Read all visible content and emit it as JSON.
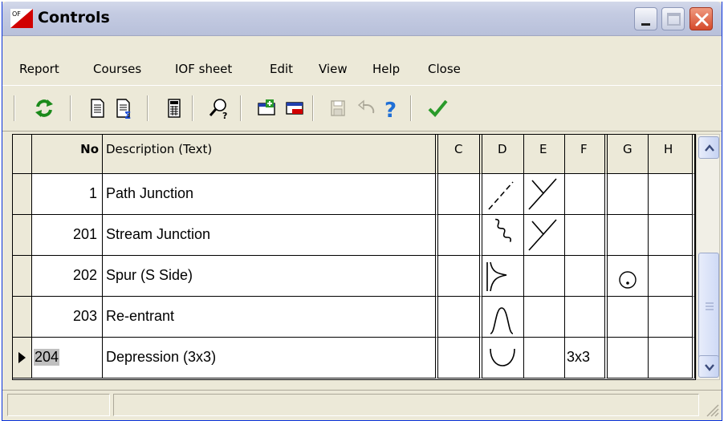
{
  "window": {
    "title": "Controls",
    "logo_text": "OF",
    "title_bar_buttons": [
      "minimize-icon",
      "maximize-icon",
      "close-icon"
    ]
  },
  "menu": {
    "items": [
      "Report",
      "Courses",
      "IOF sheet",
      "Edit",
      "View",
      "Help",
      "Close"
    ]
  },
  "toolbar": {
    "icons": [
      "refresh-icon",
      "document-icon",
      "document-sum-icon",
      "calculator-icon",
      "find-help-icon",
      "add-row-icon",
      "delete-row-icon",
      "save-icon",
      "undo-icon",
      "help-icon",
      "checkmark-icon"
    ]
  },
  "grid": {
    "columns": [
      "No",
      "Description (Text)",
      "C",
      "D",
      "E",
      "F",
      "G",
      "H"
    ],
    "rows": [
      {
        "no": "1",
        "description": "Path Junction",
        "c": "",
        "d": "path-symbol",
        "e": "junction-symbol",
        "f": "",
        "g": "",
        "h": ""
      },
      {
        "no": "201",
        "description": "Stream Junction",
        "c": "",
        "d": "stream-symbol",
        "e": "junction-symbol",
        "f": "",
        "g": "",
        "h": ""
      },
      {
        "no": "202",
        "description": "Spur (S Side)",
        "c": "",
        "d": "spur-symbol",
        "e": "",
        "f": "",
        "g": "south-side-symbol",
        "h": ""
      },
      {
        "no": "203",
        "description": "Re-entrant",
        "c": "",
        "d": "re-entrant-symbol",
        "e": "",
        "f": "",
        "g": "",
        "h": ""
      },
      {
        "no": "204",
        "description": "Depression (3x3)",
        "c": "",
        "d": "depression-symbol",
        "e": "",
        "f": "3x3",
        "g": "",
        "h": ""
      }
    ],
    "current_row_indicator": "row-pointer-icon",
    "selection_color": "#c0c0c0"
  },
  "statusbar": {
    "panels": [
      "",
      ""
    ]
  },
  "colors": {
    "close_button": "#d5492b",
    "save_check": "#2a9a2a",
    "help": "#1f6fd6",
    "refresh": "#1a8a1a"
  }
}
